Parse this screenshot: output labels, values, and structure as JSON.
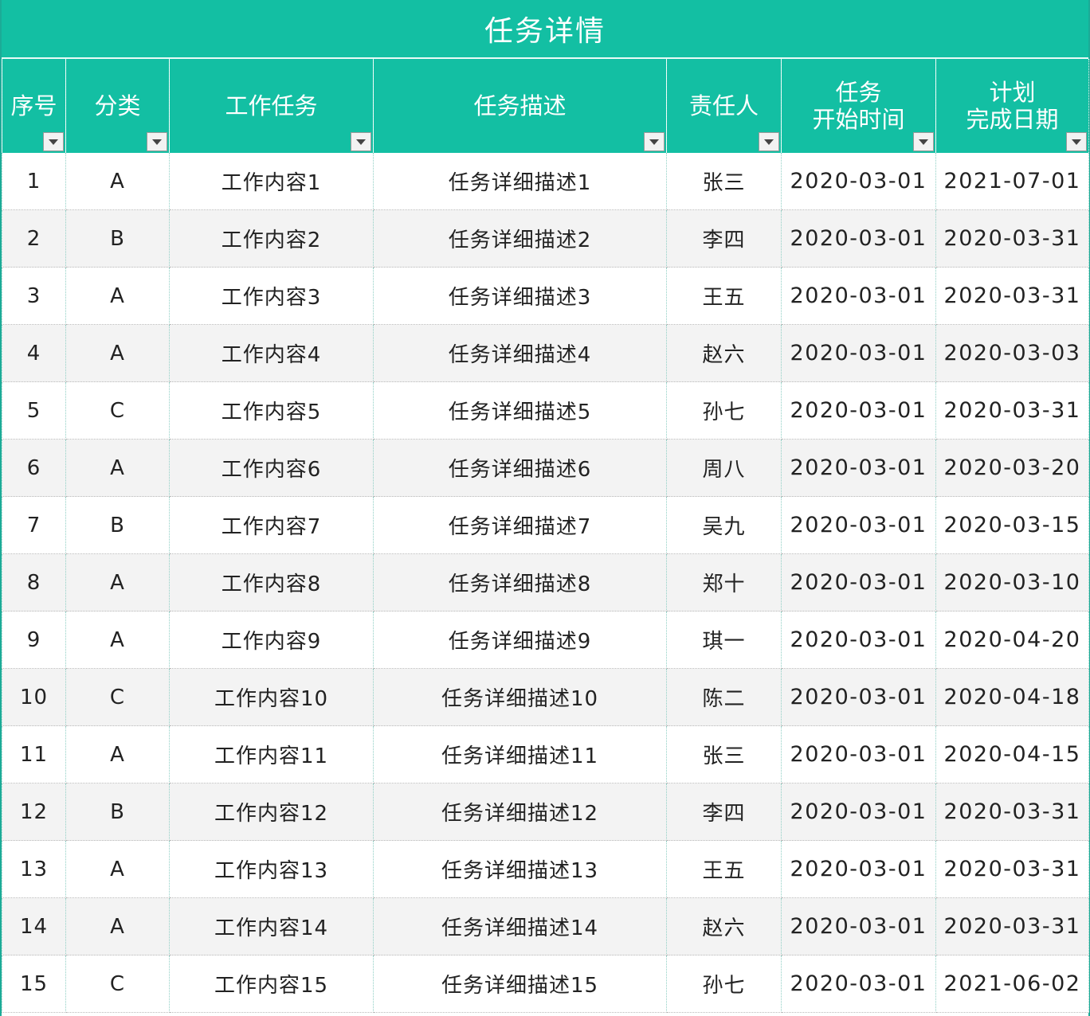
{
  "sheet": {
    "title": "任务详情",
    "colors": {
      "header_bg": "#13bfa3",
      "header_text": "#ffffff",
      "row_alt_bg": "#f3f3f3"
    },
    "columns": [
      {
        "label": "序号"
      },
      {
        "label": "分类"
      },
      {
        "label": "工作任务"
      },
      {
        "label": "任务描述"
      },
      {
        "label": "责任人"
      },
      {
        "label_line1": "任务",
        "label_line2": "开始时间"
      },
      {
        "label_line1": "计划",
        "label_line2": "完成日期"
      }
    ],
    "rows": [
      {
        "no": "1",
        "category": "A",
        "task": "工作内容1",
        "desc": "任务详细描述1",
        "owner": "张三",
        "start": "2020-03-01",
        "due": "2021-07-01"
      },
      {
        "no": "2",
        "category": "B",
        "task": "工作内容2",
        "desc": "任务详细描述2",
        "owner": "李四",
        "start": "2020-03-01",
        "due": "2020-03-31"
      },
      {
        "no": "3",
        "category": "A",
        "task": "工作内容3",
        "desc": "任务详细描述3",
        "owner": "王五",
        "start": "2020-03-01",
        "due": "2020-03-31"
      },
      {
        "no": "4",
        "category": "A",
        "task": "工作内容4",
        "desc": "任务详细描述4",
        "owner": "赵六",
        "start": "2020-03-01",
        "due": "2020-03-03"
      },
      {
        "no": "5",
        "category": "C",
        "task": "工作内容5",
        "desc": "任务详细描述5",
        "owner": "孙七",
        "start": "2020-03-01",
        "due": "2020-03-31"
      },
      {
        "no": "6",
        "category": "A",
        "task": "工作内容6",
        "desc": "任务详细描述6",
        "owner": "周八",
        "start": "2020-03-01",
        "due": "2020-03-20"
      },
      {
        "no": "7",
        "category": "B",
        "task": "工作内容7",
        "desc": "任务详细描述7",
        "owner": "吴九",
        "start": "2020-03-01",
        "due": "2020-03-15"
      },
      {
        "no": "8",
        "category": "A",
        "task": "工作内容8",
        "desc": "任务详细描述8",
        "owner": "郑十",
        "start": "2020-03-01",
        "due": "2020-03-10"
      },
      {
        "no": "9",
        "category": "A",
        "task": "工作内容9",
        "desc": "任务详细描述9",
        "owner": "琪一",
        "start": "2020-03-01",
        "due": "2020-04-20"
      },
      {
        "no": "10",
        "category": "C",
        "task": "工作内容10",
        "desc": "任务详细描述10",
        "owner": "陈二",
        "start": "2020-03-01",
        "due": "2020-04-18"
      },
      {
        "no": "11",
        "category": "A",
        "task": "工作内容11",
        "desc": "任务详细描述11",
        "owner": "张三",
        "start": "2020-03-01",
        "due": "2020-04-15"
      },
      {
        "no": "12",
        "category": "B",
        "task": "工作内容12",
        "desc": "任务详细描述12",
        "owner": "李四",
        "start": "2020-03-01",
        "due": "2020-03-31"
      },
      {
        "no": "13",
        "category": "A",
        "task": "工作内容13",
        "desc": "任务详细描述13",
        "owner": "王五",
        "start": "2020-03-01",
        "due": "2020-03-31"
      },
      {
        "no": "14",
        "category": "A",
        "task": "工作内容14",
        "desc": "任务详细描述14",
        "owner": "赵六",
        "start": "2020-03-01",
        "due": "2020-03-31"
      },
      {
        "no": "15",
        "category": "C",
        "task": "工作内容15",
        "desc": "任务详细描述15",
        "owner": "孙七",
        "start": "2020-03-01",
        "due": "2021-06-02"
      }
    ]
  }
}
